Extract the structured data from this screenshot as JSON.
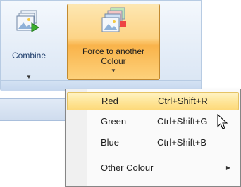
{
  "ribbon": {
    "combine_label": "Combine",
    "force_label_line1": "Force to another",
    "force_label_line2": "Colour"
  },
  "menu": {
    "items": [
      {
        "label": "Red",
        "shortcut": "Ctrl+Shift+R",
        "highlighted": true
      },
      {
        "label": "Green",
        "shortcut": "Ctrl+Shift+G"
      },
      {
        "label": "Blue",
        "shortcut": "Ctrl+Shift+B"
      },
      {
        "label": "Other Colour",
        "shortcut": "",
        "has_submenu": true
      }
    ]
  },
  "icons": {
    "combine": "combine-images-icon",
    "force": "force-colour-images-icon",
    "dropdown": "chevron-down-icon",
    "submenu": "chevron-right-icon",
    "cursor": "mouse-pointer-icon"
  },
  "colors": {
    "highlight": "#fee69a",
    "button_active": "#f9b34a",
    "ribbon_bg": "#e3ecf7"
  }
}
